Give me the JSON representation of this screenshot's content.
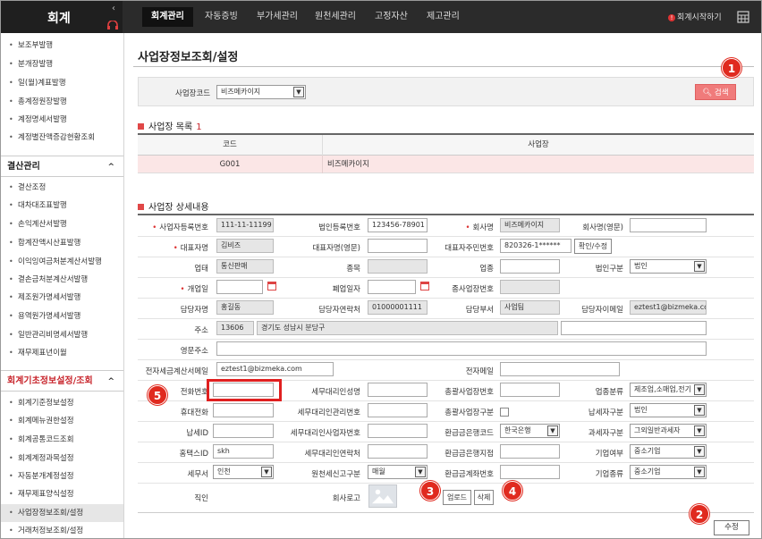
{
  "app": {
    "logo": "회계",
    "collapse": "‹",
    "start_link": "회계시작하기",
    "start_dot": "!"
  },
  "topnav": [
    "회계관리",
    "자동증빙",
    "부가세관리",
    "원천세관리",
    "고정자산",
    "제고관리"
  ],
  "sidebar": {
    "group1": [
      "보조부발행",
      "분개장발행",
      "일(월)계표발행",
      "총계정원장발행",
      "계정명세서발행",
      "계정별잔액증감현황조회"
    ],
    "head2": "결산관리",
    "group2": [
      "결산조정",
      "대차대조표발행",
      "손익계산서발행",
      "합계잔액시산표발행",
      "이익잉여금처분계산서발행",
      "결손금처분계산서발행",
      "제조원가명세서발행",
      "용역원가명세서발행",
      "일반관리비명세서발행",
      "재무제표년이월"
    ],
    "head3": "회계기초정보설정/조회",
    "group3": [
      "회계기준정보설정",
      "회계메뉴권한설정",
      "회계공통코드조회",
      "회계계정과목설정",
      "자동분개계정설정",
      "재무제표양식설정",
      "사업장정보조회/설정",
      "거래처정보조회/설정"
    ],
    "chevron": "^"
  },
  "page": {
    "title": "사업장정보조회/설정"
  },
  "search": {
    "label": "사업장코드",
    "value": "비즈메카이지",
    "button": "검색"
  },
  "list": {
    "title": "사업장 목록",
    "count": "1",
    "col_code": "코드",
    "col_name": "사업장",
    "row_code": "G001",
    "row_name": "비즈메카이지"
  },
  "detail": {
    "title": "사업장 상세내용",
    "labels": {
      "biz_no": "사업자등록번호",
      "corp_no": "법인등록번호",
      "company": "회사명",
      "company_en": "회사명(영문)",
      "ceo": "대표자명",
      "ceo_en": "대표자명(영문)",
      "ceo_id": "대표자주민번호",
      "biz_type": "업태",
      "biz_item": "종목",
      "industry": "업종",
      "corp_type": "법인구분",
      "open_date": "개업일",
      "close_date": "폐업일자",
      "sub_biz_no": "종사업장번호",
      "manager": "담당자명",
      "manager_phone": "담당자연락처",
      "manager_dept": "담당부서",
      "manager_email": "담당자이메일",
      "address": "주소",
      "address_en": "영문주소",
      "tax_email": "전자세금계산서메일",
      "e_mail": "전자메일",
      "phone": "전화번호",
      "tax_agent": "세무대리인성명",
      "hq_biz_no": "총괄사업장번호",
      "industry_cat": "업종분류",
      "mobile": "휴대전화",
      "agent_reg": "세무대리인관리번호",
      "hq_type": "총괄사업장구분",
      "payer_type": "납세자구분",
      "hometax_id": "납세ID",
      "agent_biz": "세무대리인사업자번호",
      "refund_bank": "환급금은행코드",
      "tax_type": "과세자구분",
      "hometax": "홈택스ID",
      "agent_phone": "세무대리인연락처",
      "refund_branch": "환급금은행지점",
      "corp_yn": "기업여부",
      "tax_office": "세무서",
      "withholding": "원천세신고구분",
      "refund_account": "환급금계좌번호",
      "corp_kind": "기업종류",
      "seal": "직인",
      "co_logo": "회사로고"
    },
    "values": {
      "biz_no": "111-11-11199",
      "corp_no": "123456-78901",
      "company": "비즈메카이지",
      "ceo": "김비즈",
      "ceo_id": "820326-1******",
      "ceo_id_btn": "확인/수정",
      "biz_type": "통신판매",
      "corp_type": "법인",
      "manager": "홍길동",
      "manager_phone": "01000001111",
      "manager_dept": "사업팀",
      "manager_email": "eztest1@bizmeka.co",
      "zip": "13606",
      "address": "경기도 성남시 분당구",
      "tax_email": "eztest1@bizmeka.com",
      "industry_cat": "제조업,소매업,전기",
      "payer_type": "법인",
      "refund_bank": "한국은행",
      "tax_type": "그외일반과세자",
      "hometax": "skh",
      "corp_yn": "중소기업",
      "tax_office": "인천",
      "withholding": "매월",
      "corp_kind": "중소기업",
      "upload": "업로드",
      "delete": "삭제"
    }
  },
  "footer": {
    "save": "수정"
  },
  "callouts": [
    "1",
    "2",
    "3",
    "4",
    "5"
  ]
}
